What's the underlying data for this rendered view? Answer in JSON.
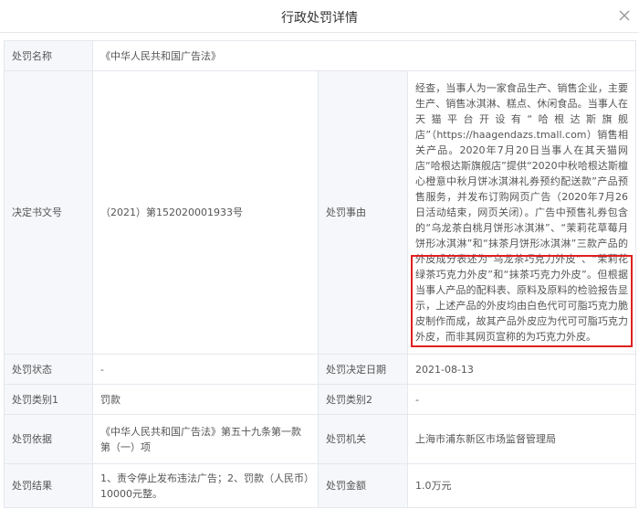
{
  "modal": {
    "title": "行政处罚详情"
  },
  "rows": {
    "penalty_name": {
      "label": "处罚名称",
      "value": "《中华人民共和国广告法》"
    },
    "decision_no": {
      "label": "决定书文号",
      "value": "（2021）第152020001933号"
    },
    "penalty_reason": {
      "label": "处罚事由",
      "text_part1": "经查，当事人为一家食品生产、销售企业，主要生产、销售冰淇淋、糕点、休闲食品。当事人在天猫平台开设有“哈根达斯旗舰店”（https://haagendazs.tmall.com）销售相关产品。2020年7月20日当事人在其天猫网店“哈根达斯旗舰店”提供“2020中秋哈根达斯檀心橙意中秋月饼冰淇淋礼券预约配送款”产品预售服务，并发布订购网页广告（2020年7月26日活动结束，网页关闭）。广告中预售礼券包含的“乌龙茶白桃月饼形冰淇淋”、“茉莉花草莓月饼形冰淇淋”和“抹茶月饼形冰淇淋”三款产品的外皮成分表述为“乌龙茶巧克力外皮”、“茉莉花绿茶巧克力外皮”和“抹茶巧克力外皮”。",
      "text_part2": "但根据当事人产品的配料表、原料及原料的检验报告显示，上述产品的外皮均由白色代可可脂巧克力脆皮制作而成，故其产品外皮应为代可可脂巧克力外皮，而非其网页宣称的为巧克力外皮。"
    },
    "penalty_status": {
      "label": "处罚状态",
      "value": "-"
    },
    "decision_date": {
      "label": "处罚决定日期",
      "value": "2021-08-13"
    },
    "category1": {
      "label": "处罚类别1",
      "value": "罚款"
    },
    "category2": {
      "label": "处罚类别2",
      "value": "-"
    },
    "basis": {
      "label": "处罚依据",
      "value": "《中华人民共和国广告法》第五十九条第一款第（一）项"
    },
    "authority": {
      "label": "处罚机关",
      "value": "上海市浦东新区市场监督管理局"
    },
    "result": {
      "label": "处罚结果",
      "value": "1、责令停止发布违法广告；2、罚款（人民币）10000元整。"
    },
    "amount": {
      "label": "处罚金额",
      "value": "1.0万元"
    }
  },
  "colors": {
    "label_bg": "#f5f7fa",
    "border": "#e4e7ed",
    "highlight": "#e02020"
  },
  "icons": {
    "close": "close-icon"
  }
}
